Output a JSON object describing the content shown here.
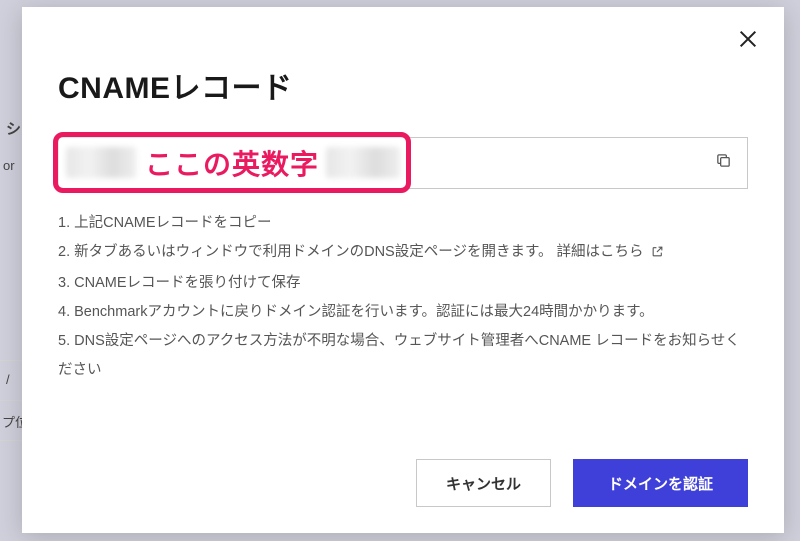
{
  "background": {
    "frag1": "シ",
    "frag2": "or",
    "frag3": "/",
    "frag4": "プ位"
  },
  "modal": {
    "title": "CNAMEレコード",
    "close_label": "閉じる",
    "cname_value": "",
    "copy_label": "コピー",
    "callout": "ここの英数字",
    "instructions": [
      "1. 上記CNAMEレコードをコピー",
      "2. 新タブあるいはウィンドウで利用ドメインのDNS設定ページを開きます。",
      "3. CNAMEレコードを張り付けて保存",
      "4. Benchmarkアカウントに戻りドメイン認証を行います。認証には最大24時間かかります。",
      "5. DNS設定ページへのアクセス方法が不明な場合、ウェブサイト管理者へCNAME レコードをお知らせください"
    ],
    "details_link": "詳細はこちら",
    "cancel": "キャンセル",
    "confirm": "ドメインを認証"
  }
}
